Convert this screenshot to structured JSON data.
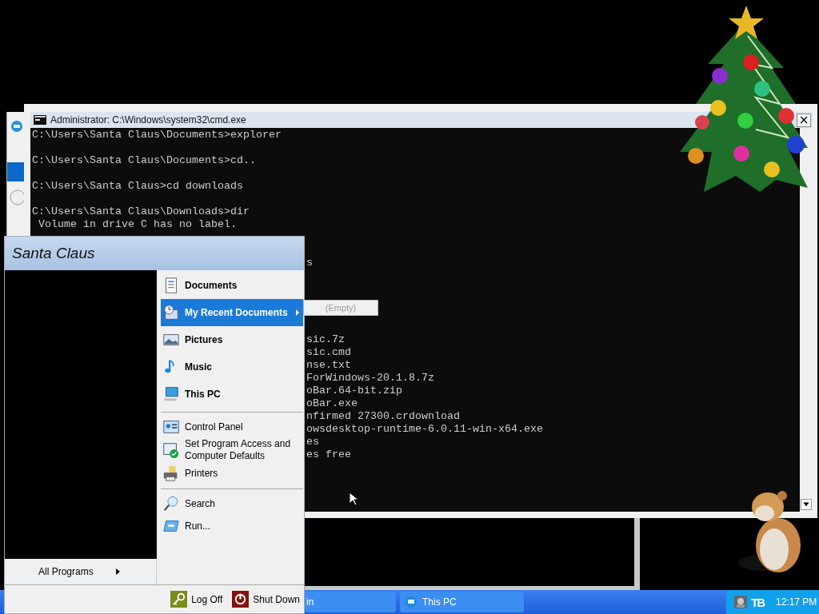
{
  "console": {
    "title": "Administrator: C:\\Windows\\system32\\cmd.exe",
    "close": "×",
    "lines": [
      {
        "kind": "full",
        "text": "C:\\Users\\Santa Claus\\Documents>explorer"
      },
      {
        "kind": "blank"
      },
      {
        "kind": "full",
        "text": "C:\\Users\\Santa Claus\\Documents>cd.."
      },
      {
        "kind": "blank"
      },
      {
        "kind": "full",
        "text": "C:\\Users\\Santa Claus>cd downloads"
      },
      {
        "kind": "blank"
      },
      {
        "kind": "full",
        "text": "C:\\Users\\Santa Claus\\Downloads>dir"
      },
      {
        "kind": "full",
        "text": " Volume in drive C has no label."
      },
      {
        "kind": "blank"
      },
      {
        "kind": "blank"
      },
      {
        "kind": "cut",
        "text": "s"
      },
      {
        "kind": "blank"
      },
      {
        "kind": "blank"
      },
      {
        "kind": "blank"
      },
      {
        "kind": "blank"
      },
      {
        "kind": "blank"
      },
      {
        "kind": "cut",
        "text": "sic.7z"
      },
      {
        "kind": "cut",
        "text": "sic.cmd"
      },
      {
        "kind": "cut",
        "text": "nse.txt"
      },
      {
        "kind": "cut",
        "text": "ForWindows-20.1.8.7z"
      },
      {
        "kind": "cut",
        "text": "oBar.64-bit.zip"
      },
      {
        "kind": "cut",
        "text": "oBar.exe"
      },
      {
        "kind": "cut",
        "text": "nfirmed 27300.crdownload"
      },
      {
        "kind": "cut",
        "text": "owsdesktop-runtime-6.0.11-win-x64.exe"
      },
      {
        "kind": "cut",
        "text": "es"
      },
      {
        "kind": "cut",
        "text": "es free"
      }
    ]
  },
  "start_menu": {
    "user": "Santa Claus",
    "all_programs": "All Programs",
    "groups": [
      {
        "kind": "places",
        "items": [
          {
            "label": "Documents",
            "selected": false,
            "submenu": false
          },
          {
            "label": "My Recent Documents",
            "selected": true,
            "submenu": true
          },
          {
            "label": "Pictures",
            "selected": false,
            "submenu": false
          },
          {
            "label": "Music",
            "selected": false,
            "submenu": false
          },
          {
            "label": "This PC",
            "selected": false,
            "submenu": false
          }
        ]
      },
      {
        "kind": "system",
        "items": [
          {
            "label": "Control Panel",
            "selected": false,
            "submenu": false
          },
          {
            "label": "Set Program Access and Computer Defaults",
            "selected": false,
            "submenu": false
          },
          {
            "label": "Printers",
            "selected": false,
            "submenu": false
          }
        ]
      },
      {
        "kind": "system",
        "items": [
          {
            "label": "Search",
            "selected": false,
            "submenu": false
          },
          {
            "label": "Run...",
            "selected": false,
            "submenu": false
          }
        ]
      }
    ],
    "submenu": {
      "items": [
        {
          "label": "(Empty)",
          "disabled": true
        }
      ]
    },
    "footer": [
      {
        "label": "Log Off"
      },
      {
        "label": "Shut Down"
      }
    ]
  },
  "taskbar": {
    "buttons": [
      {
        "label": "in"
      },
      {
        "label": "This PC"
      }
    ],
    "tray": {
      "logo": "TB",
      "clock": "12:17 PM"
    }
  }
}
